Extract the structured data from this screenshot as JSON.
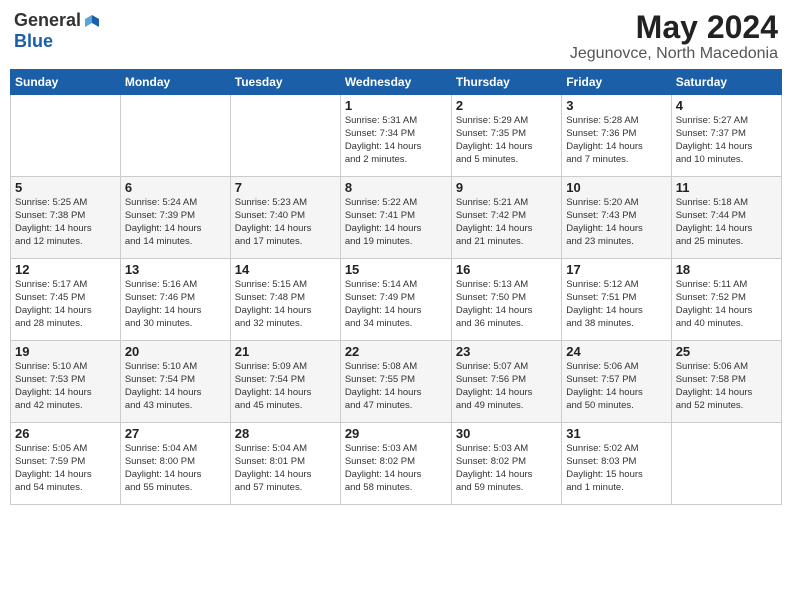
{
  "logo": {
    "general": "General",
    "blue": "Blue"
  },
  "title": {
    "month_year": "May 2024",
    "location": "Jegunovce, North Macedonia"
  },
  "weekdays": [
    "Sunday",
    "Monday",
    "Tuesday",
    "Wednesday",
    "Thursday",
    "Friday",
    "Saturday"
  ],
  "weeks": [
    [
      {
        "day": "",
        "info": ""
      },
      {
        "day": "",
        "info": ""
      },
      {
        "day": "",
        "info": ""
      },
      {
        "day": "1",
        "info": "Sunrise: 5:31 AM\nSunset: 7:34 PM\nDaylight: 14 hours\nand 2 minutes."
      },
      {
        "day": "2",
        "info": "Sunrise: 5:29 AM\nSunset: 7:35 PM\nDaylight: 14 hours\nand 5 minutes."
      },
      {
        "day": "3",
        "info": "Sunrise: 5:28 AM\nSunset: 7:36 PM\nDaylight: 14 hours\nand 7 minutes."
      },
      {
        "day": "4",
        "info": "Sunrise: 5:27 AM\nSunset: 7:37 PM\nDaylight: 14 hours\nand 10 minutes."
      }
    ],
    [
      {
        "day": "5",
        "info": "Sunrise: 5:25 AM\nSunset: 7:38 PM\nDaylight: 14 hours\nand 12 minutes."
      },
      {
        "day": "6",
        "info": "Sunrise: 5:24 AM\nSunset: 7:39 PM\nDaylight: 14 hours\nand 14 minutes."
      },
      {
        "day": "7",
        "info": "Sunrise: 5:23 AM\nSunset: 7:40 PM\nDaylight: 14 hours\nand 17 minutes."
      },
      {
        "day": "8",
        "info": "Sunrise: 5:22 AM\nSunset: 7:41 PM\nDaylight: 14 hours\nand 19 minutes."
      },
      {
        "day": "9",
        "info": "Sunrise: 5:21 AM\nSunset: 7:42 PM\nDaylight: 14 hours\nand 21 minutes."
      },
      {
        "day": "10",
        "info": "Sunrise: 5:20 AM\nSunset: 7:43 PM\nDaylight: 14 hours\nand 23 minutes."
      },
      {
        "day": "11",
        "info": "Sunrise: 5:18 AM\nSunset: 7:44 PM\nDaylight: 14 hours\nand 25 minutes."
      }
    ],
    [
      {
        "day": "12",
        "info": "Sunrise: 5:17 AM\nSunset: 7:45 PM\nDaylight: 14 hours\nand 28 minutes."
      },
      {
        "day": "13",
        "info": "Sunrise: 5:16 AM\nSunset: 7:46 PM\nDaylight: 14 hours\nand 30 minutes."
      },
      {
        "day": "14",
        "info": "Sunrise: 5:15 AM\nSunset: 7:48 PM\nDaylight: 14 hours\nand 32 minutes."
      },
      {
        "day": "15",
        "info": "Sunrise: 5:14 AM\nSunset: 7:49 PM\nDaylight: 14 hours\nand 34 minutes."
      },
      {
        "day": "16",
        "info": "Sunrise: 5:13 AM\nSunset: 7:50 PM\nDaylight: 14 hours\nand 36 minutes."
      },
      {
        "day": "17",
        "info": "Sunrise: 5:12 AM\nSunset: 7:51 PM\nDaylight: 14 hours\nand 38 minutes."
      },
      {
        "day": "18",
        "info": "Sunrise: 5:11 AM\nSunset: 7:52 PM\nDaylight: 14 hours\nand 40 minutes."
      }
    ],
    [
      {
        "day": "19",
        "info": "Sunrise: 5:10 AM\nSunset: 7:53 PM\nDaylight: 14 hours\nand 42 minutes."
      },
      {
        "day": "20",
        "info": "Sunrise: 5:10 AM\nSunset: 7:54 PM\nDaylight: 14 hours\nand 43 minutes."
      },
      {
        "day": "21",
        "info": "Sunrise: 5:09 AM\nSunset: 7:54 PM\nDaylight: 14 hours\nand 45 minutes."
      },
      {
        "day": "22",
        "info": "Sunrise: 5:08 AM\nSunset: 7:55 PM\nDaylight: 14 hours\nand 47 minutes."
      },
      {
        "day": "23",
        "info": "Sunrise: 5:07 AM\nSunset: 7:56 PM\nDaylight: 14 hours\nand 49 minutes."
      },
      {
        "day": "24",
        "info": "Sunrise: 5:06 AM\nSunset: 7:57 PM\nDaylight: 14 hours\nand 50 minutes."
      },
      {
        "day": "25",
        "info": "Sunrise: 5:06 AM\nSunset: 7:58 PM\nDaylight: 14 hours\nand 52 minutes."
      }
    ],
    [
      {
        "day": "26",
        "info": "Sunrise: 5:05 AM\nSunset: 7:59 PM\nDaylight: 14 hours\nand 54 minutes."
      },
      {
        "day": "27",
        "info": "Sunrise: 5:04 AM\nSunset: 8:00 PM\nDaylight: 14 hours\nand 55 minutes."
      },
      {
        "day": "28",
        "info": "Sunrise: 5:04 AM\nSunset: 8:01 PM\nDaylight: 14 hours\nand 57 minutes."
      },
      {
        "day": "29",
        "info": "Sunrise: 5:03 AM\nSunset: 8:02 PM\nDaylight: 14 hours\nand 58 minutes."
      },
      {
        "day": "30",
        "info": "Sunrise: 5:03 AM\nSunset: 8:02 PM\nDaylight: 14 hours\nand 59 minutes."
      },
      {
        "day": "31",
        "info": "Sunrise: 5:02 AM\nSunset: 8:03 PM\nDaylight: 15 hours\nand 1 minute."
      },
      {
        "day": "",
        "info": ""
      }
    ]
  ]
}
